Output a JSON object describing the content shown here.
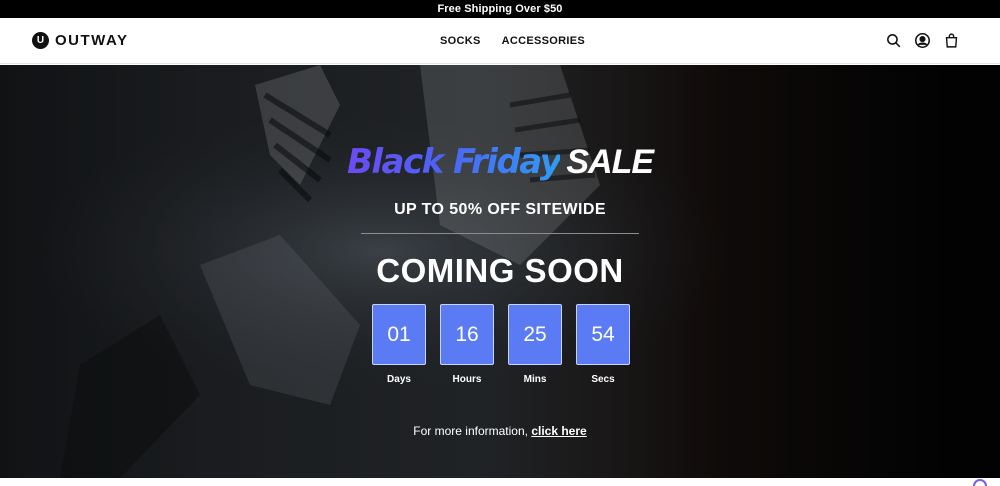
{
  "announcement": {
    "text": "Free Shipping Over $50"
  },
  "header": {
    "logo_mark": "U",
    "logo_text": "OUTWAY",
    "nav": [
      {
        "label": "SOCKS"
      },
      {
        "label": "ACCESSORIES"
      }
    ],
    "icons": [
      "search-icon",
      "account-icon",
      "cart-icon"
    ]
  },
  "hero": {
    "headline_part1": "Black Friday",
    "headline_part2": "SALE",
    "subhead": "UP TO 50% OFF SITEWIDE",
    "coming": "COMING SOON",
    "countdown": [
      {
        "value": "01",
        "label": "Days"
      },
      {
        "value": "16",
        "label": "Hours"
      },
      {
        "value": "25",
        "label": "Mins"
      },
      {
        "value": "54",
        "label": "Secs"
      }
    ],
    "info_text": "For more information,",
    "info_link": "click here"
  },
  "colors": {
    "accent": "#5b7bf5",
    "gradient_start": "#6c4bf2",
    "gradient_end": "#2f9bf7",
    "announcement_bg": "#000000"
  }
}
